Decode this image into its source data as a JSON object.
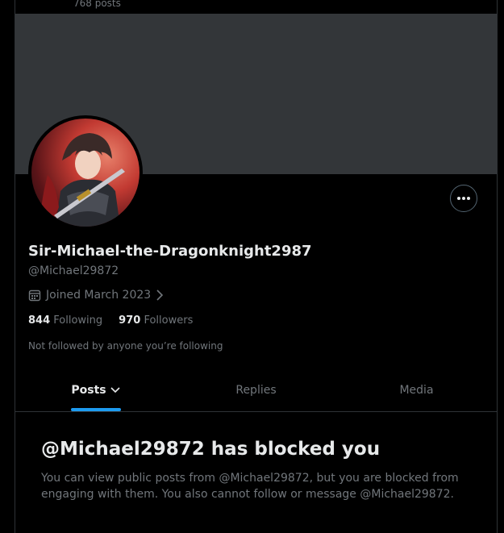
{
  "header": {
    "post_count": "768 posts"
  },
  "profile": {
    "display_name": "Sir-Michael-the-Dragonknight2987",
    "handle": "@Michael29872",
    "joined": "Joined March 2023",
    "following_count": "844",
    "following_label": "Following",
    "followers_count": "970",
    "followers_label": "Followers",
    "not_followed_text": "Not followed by anyone you’re following"
  },
  "icons": {
    "more": "more-horizontal-icon",
    "calendar": "calendar-icon",
    "chevron_right": "chevron-right-icon",
    "chevron_down": "chevron-down-icon"
  },
  "tabs": [
    {
      "label": "Posts",
      "active": true
    },
    {
      "label": "Replies",
      "active": false
    },
    {
      "label": "Media",
      "active": false
    }
  ],
  "blocked": {
    "title": "@Michael29872 has blocked you",
    "body": "You can view public posts from @Michael29872, but you are blocked from engaging with them. You also cannot follow or message @Michael29872."
  },
  "colors": {
    "background": "#000000",
    "banner": "#333639",
    "accent": "#1d9bf0",
    "text_primary": "#e7e9ea",
    "text_secondary": "#71767b",
    "border": "#2f3336"
  }
}
